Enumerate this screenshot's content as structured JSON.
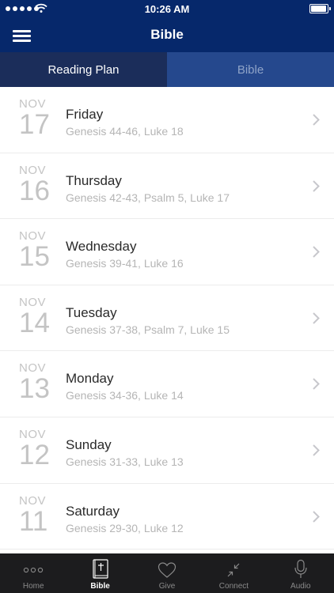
{
  "status_bar": {
    "time": "10:26 AM",
    "battery_level": 0.95
  },
  "header": {
    "title": "Bible",
    "menu_icon": "hamburger-menu-icon"
  },
  "tabs": [
    {
      "label": "Reading Plan",
      "active": true
    },
    {
      "label": "Bible",
      "active": false
    }
  ],
  "readings": [
    {
      "month": "NOV",
      "day": "17",
      "weekday": "Friday",
      "passage": "Genesis 44-46, Luke 18"
    },
    {
      "month": "NOV",
      "day": "16",
      "weekday": "Thursday",
      "passage": "Genesis 42-43, Psalm 5, Luke 17"
    },
    {
      "month": "NOV",
      "day": "15",
      "weekday": "Wednesday",
      "passage": "Genesis 39-41, Luke 16"
    },
    {
      "month": "NOV",
      "day": "14",
      "weekday": "Tuesday",
      "passage": "Genesis 37-38, Psalm 7, Luke 15"
    },
    {
      "month": "NOV",
      "day": "13",
      "weekday": "Monday",
      "passage": "Genesis 34-36, Luke 14"
    },
    {
      "month": "NOV",
      "day": "12",
      "weekday": "Sunday",
      "passage": "Genesis 31-33, Luke 13"
    },
    {
      "month": "NOV",
      "day": "11",
      "weekday": "Saturday",
      "passage": "Genesis 29-30, Luke 12"
    }
  ],
  "bottom_nav": [
    {
      "label": "Home",
      "icon": "dots-icon",
      "active": false
    },
    {
      "label": "Bible",
      "icon": "bible-book-icon",
      "active": true
    },
    {
      "label": "Give",
      "icon": "heart-icon",
      "active": false
    },
    {
      "label": "Connect",
      "icon": "connect-arrows-icon",
      "active": false
    },
    {
      "label": "Audio",
      "icon": "microphone-icon",
      "active": false
    }
  ],
  "colors": {
    "header_bg": "#06286b",
    "tab_active_bg": "#1b2d5a",
    "tab_inactive_bg": "#25488d",
    "bottom_bar_bg": "#1c1c1e"
  }
}
